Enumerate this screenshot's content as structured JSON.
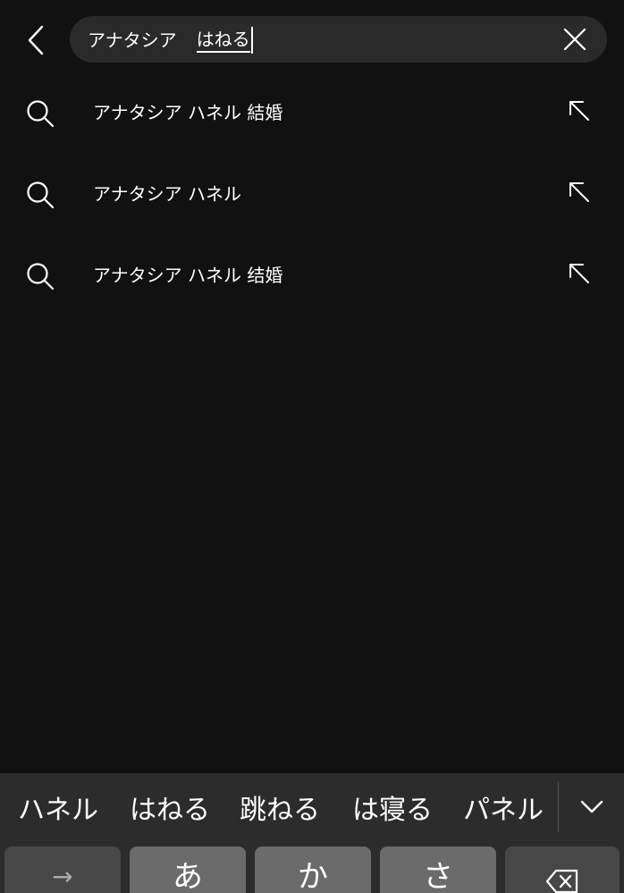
{
  "search": {
    "committed_text": "アナタシア",
    "composing_text": "はねる"
  },
  "suggestions": [
    {
      "label": "アナタシア ハネル 結婚"
    },
    {
      "label": "アナタシア ハネル"
    },
    {
      "label": "アナタシア ハネル 结婚"
    }
  ],
  "keyboard": {
    "candidates": [
      "ハネル",
      "はねる",
      "跳ねる",
      "は寝る",
      "パネル"
    ],
    "keys": {
      "arrow": "→",
      "a": "あ",
      "ka": "か",
      "sa": "さ"
    }
  },
  "icons": {
    "back": "chevron-left-icon",
    "clear": "close-icon",
    "search": "search-icon",
    "fill": "arrow-up-left-icon",
    "expand": "chevron-down-icon",
    "delete": "backspace-icon"
  },
  "colors": {
    "background": "#111111",
    "search_box": "#2a2a2a",
    "keyboard": "#2c2c2c",
    "key_light": "#6b6b6b",
    "key_dark": "#474747"
  }
}
